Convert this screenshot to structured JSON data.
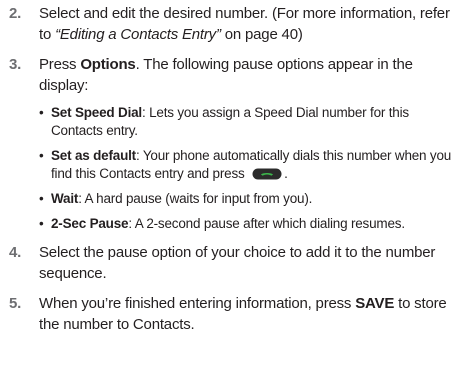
{
  "steps": [
    {
      "num": "2.",
      "text_a": "Select and edit the desired number. (For more information, refer to ",
      "link": "“Editing a Contacts Entry”",
      "text_b": " on page 40)"
    },
    {
      "num": "3.",
      "text_a": "Press ",
      "bold": "Options",
      "text_b": ". The following pause options appear in the display:",
      "bullets": [
        {
          "dot": "•",
          "term": "Set Speed Dial",
          "desc": ": Lets you assign a Speed Dial number for this Contacts entry."
        },
        {
          "dot": "•",
          "term": "Set as default",
          "desc": ": Your phone automatically dials this number when you find this Contacts entry and press",
          "after_icon": "."
        },
        {
          "dot": "•",
          "term": "Wait",
          "desc": ": A hard pause (waits for input from you)."
        },
        {
          "dot": "•",
          "term": "2-Sec Pause",
          "desc": ": A 2-second pause after which dialing resumes."
        }
      ]
    },
    {
      "num": "4.",
      "text": "Select the pause option of your choice to add it to the number sequence."
    },
    {
      "num": "5.",
      "text_a": "When you’re finished entering information, press ",
      "bold": "SAVE",
      "text_b": " to store the number to Contacts."
    }
  ],
  "icons": {
    "send_key": "send-key-icon",
    "send_key_color": "#2e8b3a"
  },
  "colors": {
    "text": "#231f20",
    "step_number": "#6d6e71"
  }
}
